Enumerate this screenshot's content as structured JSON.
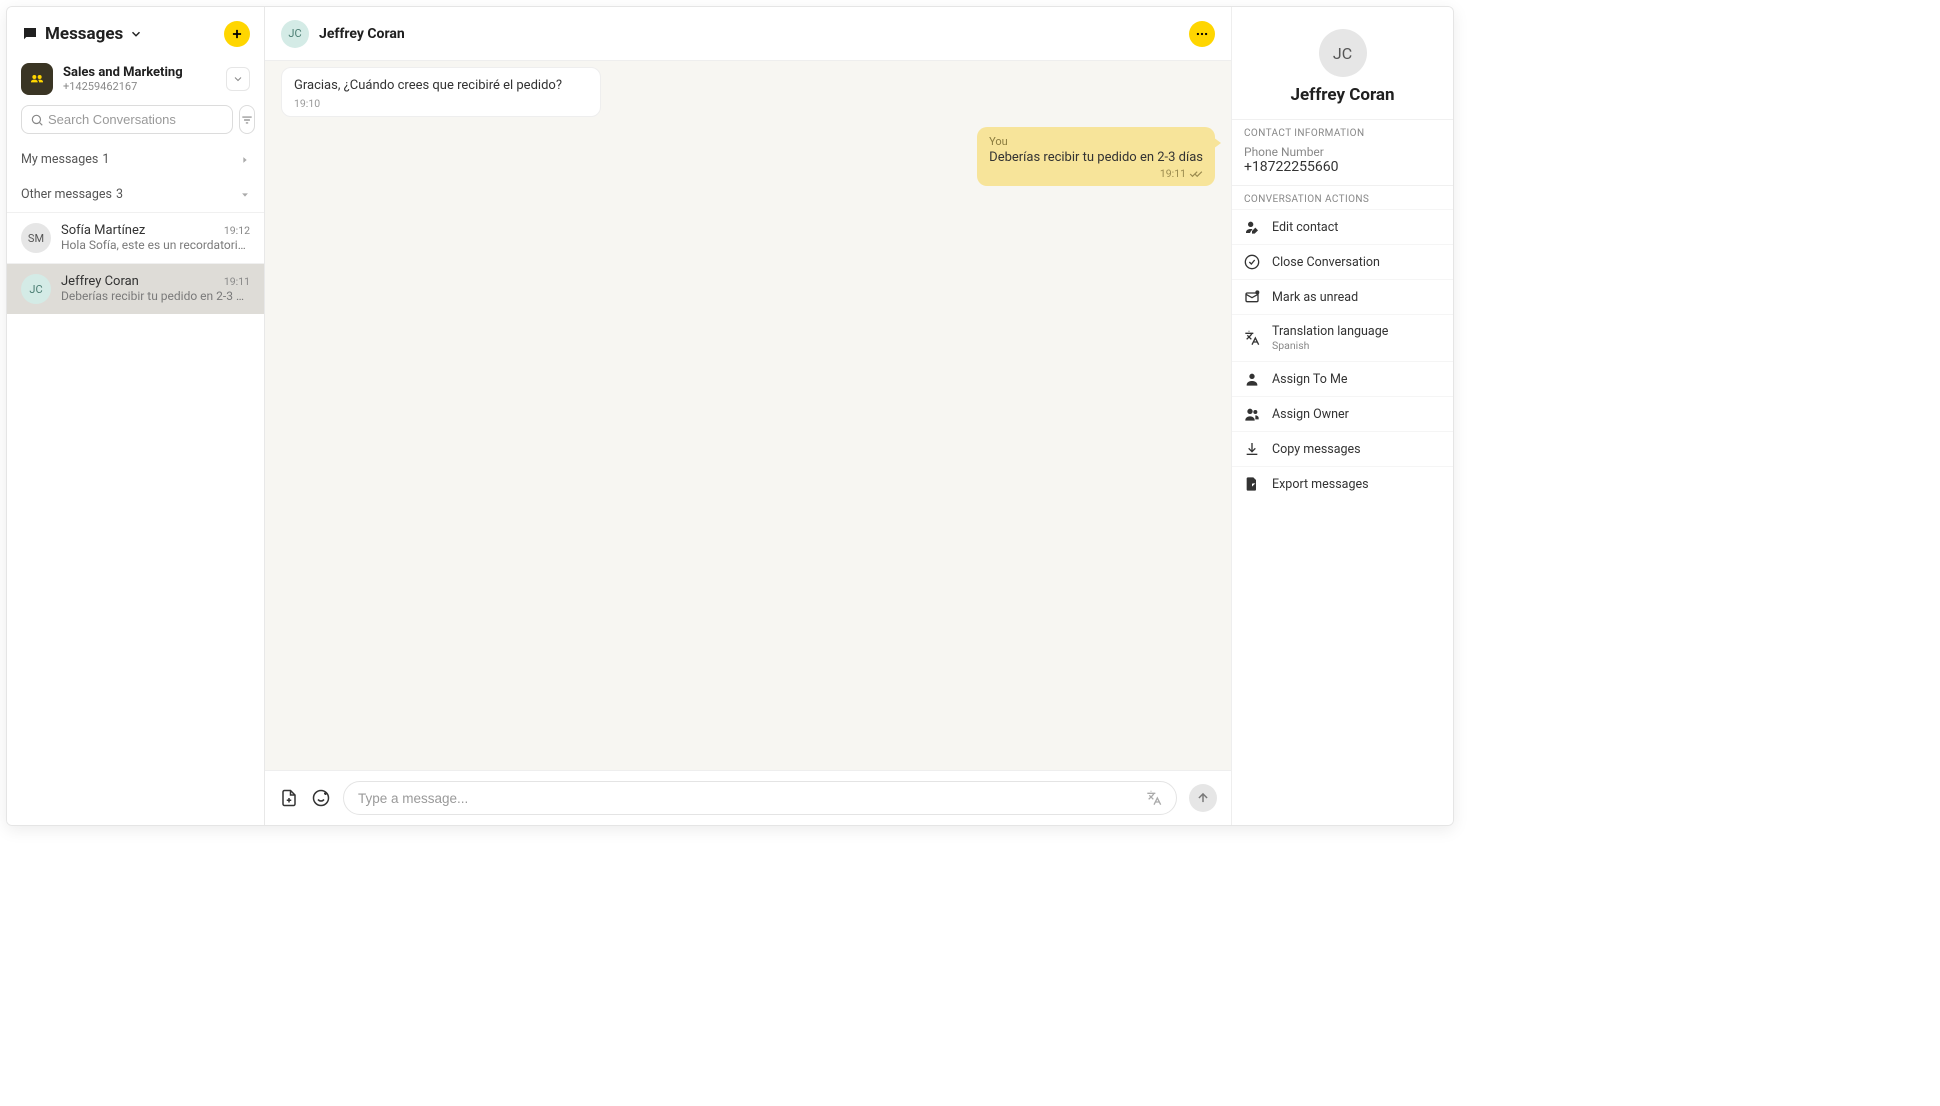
{
  "sidebar": {
    "title": "Messages",
    "account": {
      "name": "Sales and Marketing",
      "number": "+14259462167"
    },
    "search_placeholder": "Search Conversations",
    "sections": {
      "my": {
        "label": "My messages",
        "count": "1"
      },
      "other": {
        "label": "Other messages",
        "count": "3"
      }
    },
    "conversations": [
      {
        "initials": "SM",
        "name": "Sofía Martínez",
        "time": "19:12",
        "preview": "Hola Sofía, este es un recordatorio rá..."
      },
      {
        "initials": "JC",
        "name": "Jeffrey Coran",
        "time": "19:11",
        "preview": "Deberías recibir tu pedido en 2-3 días"
      }
    ]
  },
  "header": {
    "initials": "JC",
    "name": "Jeffrey Coran"
  },
  "messages": {
    "incoming": {
      "text": "Gracias, ¿Cuándo crees que recibiré el pedido?",
      "time": "19:10"
    },
    "outgoing": {
      "sender": "You",
      "text": "Deberías recibir tu pedido en 2-3 días",
      "time": "19:11"
    }
  },
  "composer": {
    "placeholder": "Type a message..."
  },
  "details": {
    "initials": "JC",
    "name": "Jeffrey Coran",
    "contact_info_label": "CONTACT INFORMATION",
    "phone_label": "Phone Number",
    "phone_value": "+18722255660",
    "conversation_actions_label": "CONVERSATION ACTIONS",
    "actions": {
      "edit_contact": "Edit contact",
      "close_conversation": "Close Conversation",
      "mark_unread": "Mark as unread",
      "translation_language": "Translation language",
      "translation_sub": "Spanish",
      "assign_me": "Assign To Me",
      "assign_owner": "Assign Owner",
      "copy_messages": "Copy messages",
      "export_messages": "Export messages"
    }
  }
}
